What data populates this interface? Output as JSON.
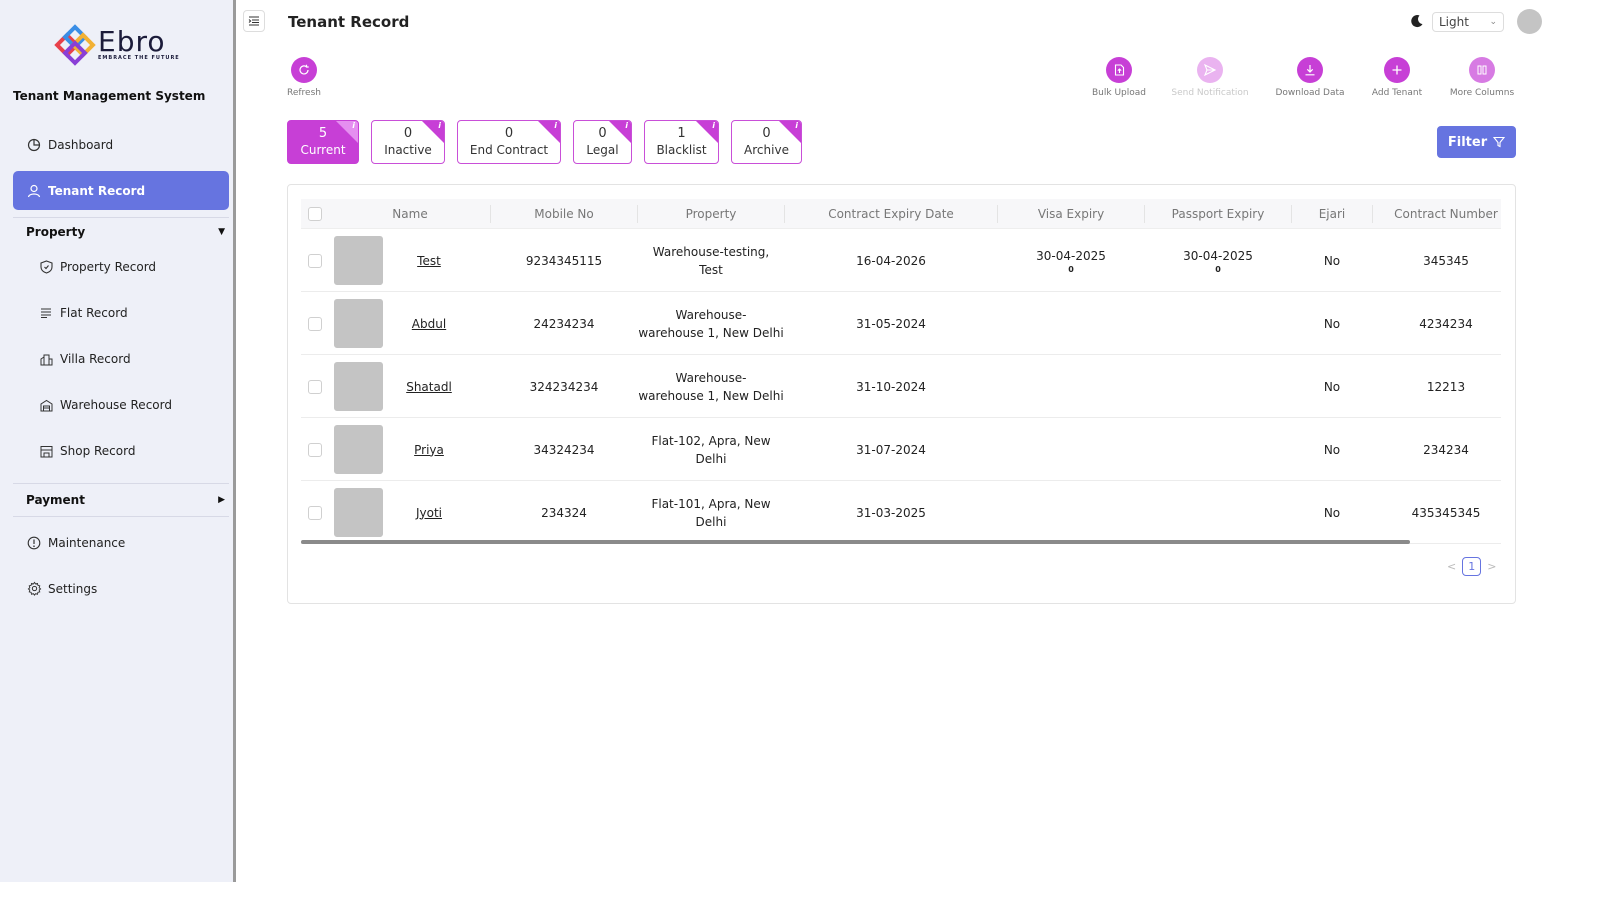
{
  "app": {
    "logo_text": "Ebro",
    "logo_tagline": "EMBRACE THE FUTURE",
    "title": "Tenant Management System"
  },
  "sidebar": {
    "dashboard": "Dashboard",
    "tenant_record": "Tenant Record",
    "property_section": "Property",
    "property_items": [
      "Property Record",
      "Flat Record",
      "Villa Record",
      "Warehouse Record",
      "Shop Record"
    ],
    "payment_section": "Payment",
    "maintenance": "Maintenance",
    "settings": "Settings"
  },
  "header": {
    "page_title": "Tenant Record",
    "theme_value": "Light"
  },
  "actions": {
    "refresh": "Refresh",
    "bulk_upload": "Bulk Upload",
    "send_notification": "Send Notification",
    "download_data": "Download Data",
    "add_tenant": "Add Tenant",
    "more_columns": "More Columns"
  },
  "status_cards": [
    {
      "count": "5",
      "label": "Current",
      "active": true
    },
    {
      "count": "0",
      "label": "Inactive"
    },
    {
      "count": "0",
      "label": "End Contract"
    },
    {
      "count": "0",
      "label": "Legal"
    },
    {
      "count": "1",
      "label": "Blacklist"
    },
    {
      "count": "0",
      "label": "Archive"
    }
  ],
  "filter_label": "Filter",
  "table": {
    "columns": [
      "Name",
      "Mobile No",
      "Property",
      "Contract Expiry Date",
      "Visa Expiry",
      "Passport Expiry",
      "Ejari",
      "Contract Number"
    ],
    "rows": [
      {
        "name": "Test",
        "mobile": "9234345115",
        "property_l1": "Warehouse-testing,",
        "property_l2": "Test",
        "contract_expiry": "16-04-2026",
        "visa_expiry": "30-04-2025",
        "visa_sub": "0",
        "passport_expiry": "30-04-2025",
        "passport_sub": "0",
        "ejari": "No",
        "contract_number": "345345"
      },
      {
        "name": "Abdul",
        "mobile": "24234234",
        "property_l1": "Warehouse-",
        "property_l2": "warehouse 1, New Delhi",
        "contract_expiry": "31-05-2024",
        "visa_expiry": "",
        "visa_sub": "",
        "passport_expiry": "",
        "passport_sub": "",
        "ejari": "No",
        "contract_number": "4234234"
      },
      {
        "name": "Shatadl",
        "mobile": "324234234",
        "property_l1": "Warehouse-",
        "property_l2": "warehouse 1, New Delhi",
        "contract_expiry": "31-10-2024",
        "visa_expiry": "",
        "visa_sub": "",
        "passport_expiry": "",
        "passport_sub": "",
        "ejari": "No",
        "contract_number": "12213"
      },
      {
        "name": "Priya",
        "mobile": "34324234",
        "property_l1": "Flat-102, Apra, New",
        "property_l2": "Delhi",
        "contract_expiry": "31-07-2024",
        "visa_expiry": "",
        "visa_sub": "",
        "passport_expiry": "",
        "passport_sub": "",
        "ejari": "No",
        "contract_number": "234234"
      },
      {
        "name": "Jyoti",
        "mobile": "234324",
        "property_l1": "Flat-101, Apra, New",
        "property_l2": "Delhi",
        "contract_expiry": "31-03-2025",
        "visa_expiry": "",
        "visa_sub": "",
        "passport_expiry": "",
        "passport_sub": "",
        "ejari": "No",
        "contract_number": "435345345"
      }
    ]
  },
  "pagination": {
    "current_page": "1",
    "prev": "<",
    "next": ">"
  },
  "colors": {
    "accent": "#c73fd6",
    "primary": "#6674e0",
    "sidebar_bg": "#eef0f8"
  }
}
